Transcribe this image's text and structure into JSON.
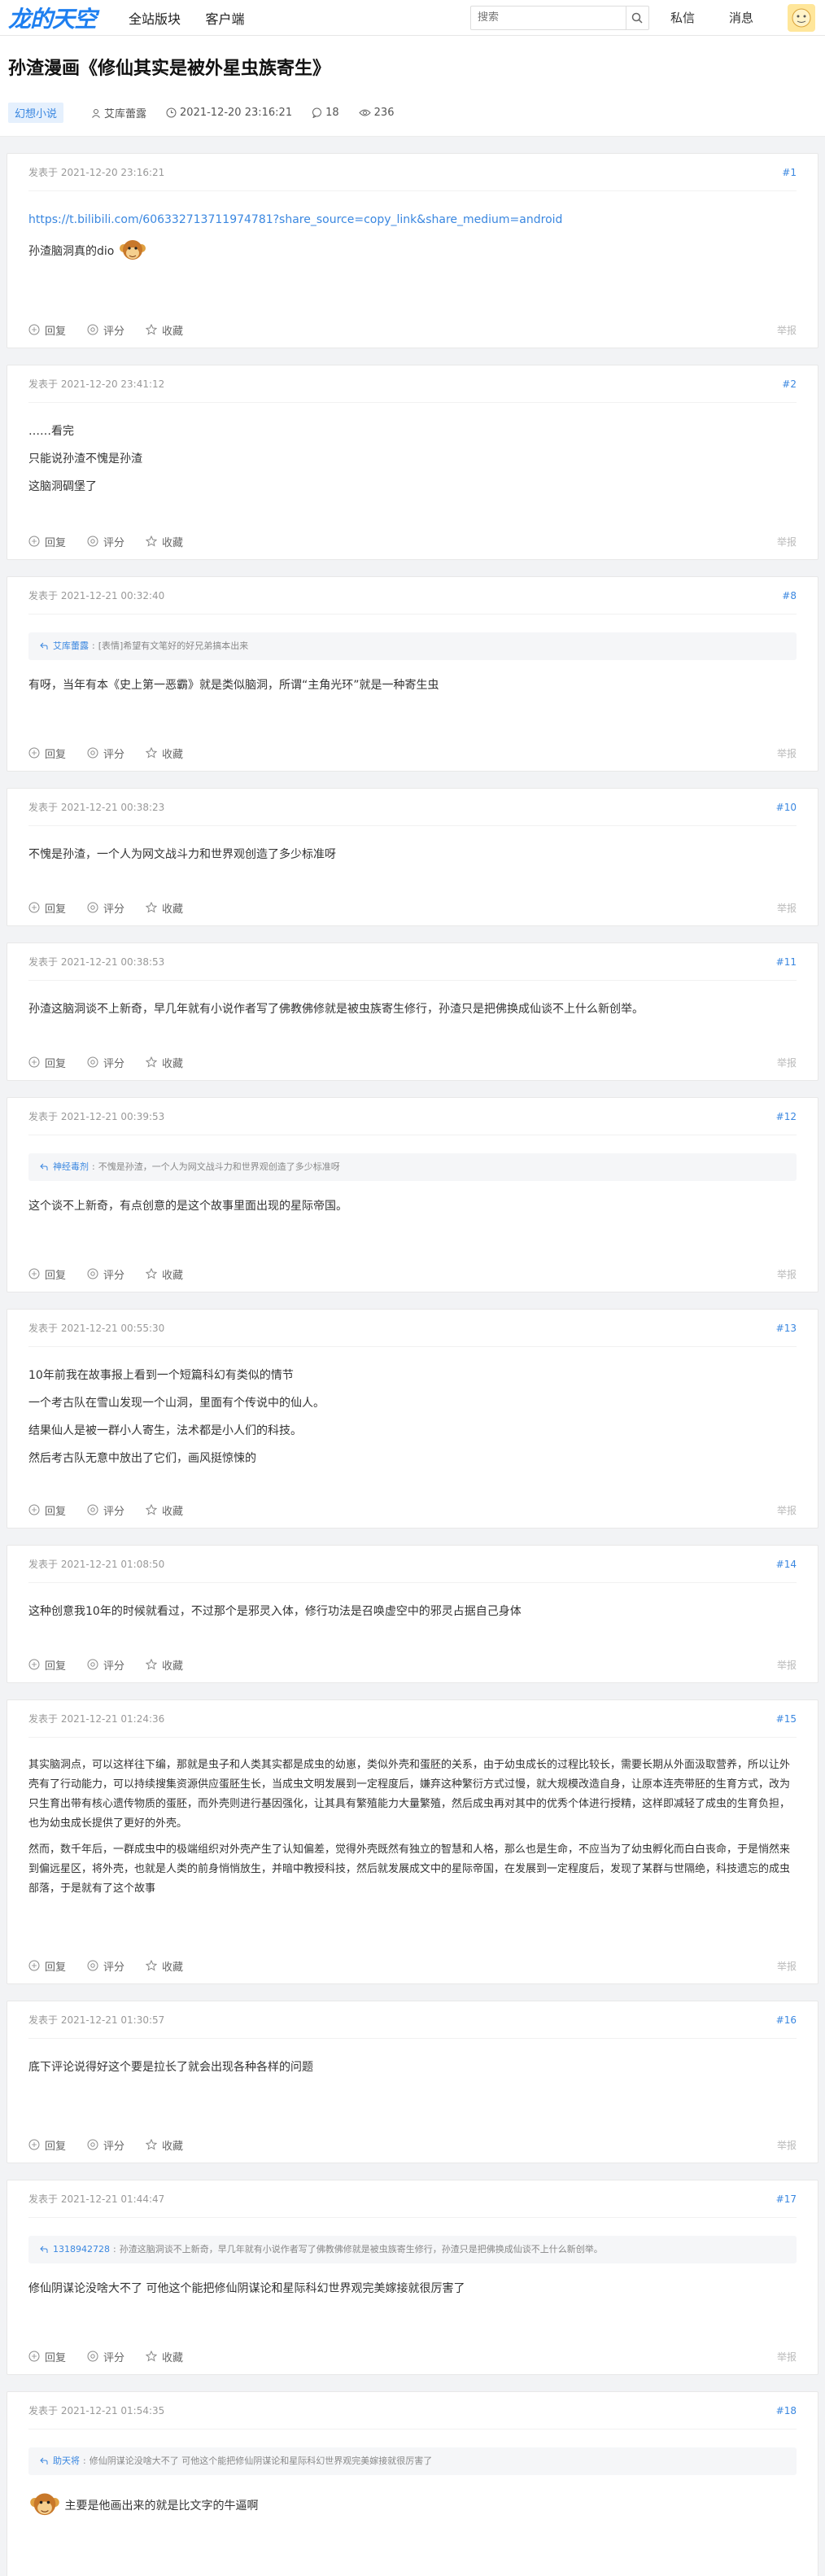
{
  "site": {
    "logo": "龙的天空",
    "nav": [
      "全站版块",
      "客户端"
    ],
    "search_placeholder": "搜索",
    "messages": "私信",
    "notifications": "消息"
  },
  "thread": {
    "title": "孙渣漫画《修仙其实是被外星虫族寄生》",
    "tag": "幻想小说",
    "author": "艾库蕾露",
    "datetime": "2021-12-20 23:16:21",
    "comments": "18",
    "views": "236"
  },
  "labels": {
    "posted_prefix": "发表于",
    "reply": "回复",
    "rate": "评分",
    "favorite": "收藏",
    "report": "举报"
  },
  "posts": [
    {
      "time": "2021-12-20 23:16:21",
      "num": "#1",
      "link": "https://t.bilibili.com/606332713711974781?share_source=copy_link&share_medium=android",
      "lines": [
        "孙渣脑洞真的dio"
      ]
    },
    {
      "time": "2021-12-20 23:41:12",
      "num": "#2",
      "lines": [
        "……看完",
        "只能说孙渣不愧是孙渣",
        "这脑洞碉堡了"
      ]
    },
    {
      "time": "2021-12-21 00:32:40",
      "num": "#8",
      "quote_name": "艾库蕾露",
      "quote_text": "[表情]希望有文笔好的好兄弟搞本出来",
      "lines": [
        "有呀，当年有本《史上第一恶霸》就是类似脑洞，所谓“主角光环”就是一种寄生虫"
      ]
    },
    {
      "time": "2021-12-21 00:38:23",
      "num": "#10",
      "lines": [
        "不愧是孙渣，一个人为网文战斗力和世界观创造了多少标准呀"
      ]
    },
    {
      "time": "2021-12-21 00:38:53",
      "num": "#11",
      "lines": [
        "孙渣这脑洞谈不上新奇，早几年就有小说作者写了佛教佛修就是被虫族寄生修行，孙渣只是把佛换成仙谈不上什么新创举。"
      ]
    },
    {
      "time": "2021-12-21 00:39:53",
      "num": "#12",
      "quote_name": "神经毒剂",
      "quote_text": "不愧是孙渣，一个人为网文战斗力和世界观创造了多少标准呀",
      "lines": [
        "这个谈不上新奇，有点创意的是这个故事里面出现的星际帝国。"
      ]
    },
    {
      "time": "2021-12-21 00:55:30",
      "num": "#13",
      "lines": [
        "10年前我在故事报上看到一个短篇科幻有类似的情节",
        "一个考古队在雪山发现一个山洞，里面有个传说中的仙人。",
        "结果仙人是被一群小人寄生，法术都是小人们的科技。",
        "然后考古队无意中放出了它们，画风挺惊悚的"
      ]
    },
    {
      "time": "2021-12-21 01:08:50",
      "num": "#14",
      "lines": [
        "这种创意我10年的时候就看过，不过那个是邪灵入体，修行功法是召唤虚空中的邪灵占据自己身体"
      ]
    },
    {
      "time": "2021-12-21 01:24:36",
      "num": "#15",
      "lines": [
        "其实脑洞点，可以这样往下编，那就是虫子和人类其实都是成虫的幼崽，类似外壳和蛋胚的关系，由于幼虫成长的过程比较长，需要长期从外面汲取营养，所以让外壳有了行动能力，可以持续搜集资源供应蛋胚生长，当成虫文明发展到一定程度后，嫌弃这种繁衍方式过慢，就大规模改造自身，让原本连壳带胚的生育方式，改为只生育出带有核心遗传物质的蛋胚，而外壳则进行基因强化，让其具有繁殖能力大量繁殖，然后成虫再对其中的优秀个体进行授精，这样即减轻了成虫的生育负担，也为幼虫成长提供了更好的外壳。",
        "然而，数千年后，一群成虫中的极端组织对外壳产生了认知偏差，觉得外壳既然有独立的智慧和人格，那么也是生命，不应当为了幼虫孵化而白白丧命，于是悄然来到偏远星区，将外壳，也就是人类的前身悄悄放生，并暗中教授科技，然后就发展成文中的星际帝国，在发展到一定程度后，发现了某群与世隔绝，科技遗忘的成虫部落，于是就有了这个故事"
      ]
    },
    {
      "time": "2021-12-21 01:30:57",
      "num": "#16",
      "lines": [
        "底下评论说得好这个要是拉长了就会出现各种各样的问题"
      ]
    },
    {
      "time": "2021-12-21 01:44:47",
      "num": "#17",
      "quote_name": "1318942728",
      "quote_text": "孙渣这脑洞谈不上新奇，早几年就有小说作者写了佛教佛修就是被虫族寄生修行，孙渣只是把佛换成仙谈不上什么新创举。",
      "lines": [
        "修仙阴谋论没啥大不了 可他这个能把修仙阴谋论和星际科幻世界观完美嫁接就很厉害了"
      ]
    },
    {
      "time": "2021-12-21 01:54:35",
      "num": "#18",
      "quote_name": "助天将",
      "quote_text": "修仙阴谋论没啥大不了 可他这个能把修仙阴谋论和星际科幻世界观完美嫁接就很厉害了",
      "lines": [
        "主要是他画出来的就是比文字的牛逼啊"
      ]
    }
  ]
}
